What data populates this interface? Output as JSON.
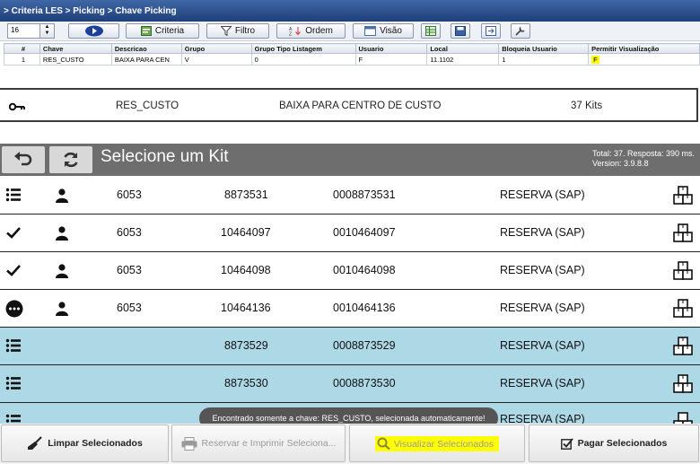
{
  "breadcrumb": {
    "text": "> Criteria LES > Picking > Chave Picking"
  },
  "toolbar": {
    "page_size": "16",
    "criteria_label": "Criteria",
    "filtro_label": "Filtro",
    "ordem_label": "Ordem",
    "visao_label": "Visão"
  },
  "grid": {
    "columns": [
      "#",
      "Chave",
      "Descricao",
      "Grupo",
      "Grupo Tipo Listagem",
      "Usuario",
      "Local",
      "Bloqueia Usuario",
      "Permitir Visualização"
    ],
    "row": [
      "1",
      "RES_CUSTO",
      "BAIXA PARA CEN",
      "V",
      "0",
      "F",
      "11.1102",
      "1",
      "F"
    ]
  },
  "summary": {
    "key": "RES_CUSTO",
    "description": "BAIXA PARA CENTRO DE CUSTO",
    "kits": "37 Kits"
  },
  "kit_header": {
    "title": "Selecione um Kit",
    "stats": "Total: 37. Resposta: 390 ms.",
    "version": "Version: 3.9.8.8"
  },
  "rows": [
    {
      "status_icon": "list-icon",
      "user": true,
      "code": "6053",
      "kit": "8873531",
      "padded": "0008873531",
      "label": "RESERVA (SAP)",
      "style": "white"
    },
    {
      "status_icon": "check-icon",
      "user": true,
      "code": "6053",
      "kit": "10464097",
      "padded": "0010464097",
      "label": "RESERVA (SAP)",
      "style": "white"
    },
    {
      "status_icon": "check-icon",
      "user": true,
      "code": "6053",
      "kit": "10464098",
      "padded": "0010464098",
      "label": "RESERVA (SAP)",
      "style": "white"
    },
    {
      "status_icon": "more-icon",
      "user": true,
      "code": "6053",
      "kit": "10464136",
      "padded": "0010464136",
      "label": "RESERVA (SAP)",
      "style": "white"
    },
    {
      "status_icon": "list-icon",
      "user": false,
      "code": "",
      "kit": "8873529",
      "padded": "0008873529",
      "label": "RESERVA (SAP)",
      "style": "blue"
    },
    {
      "status_icon": "list-icon",
      "user": false,
      "code": "",
      "kit": "8873530",
      "padded": "0008873530",
      "label": "RESERVA (SAP)",
      "style": "blue"
    },
    {
      "status_icon": "list-icon",
      "user": false,
      "code": "",
      "kit": "",
      "padded": "",
      "label": "RESERVA (SAP)",
      "style": "blue"
    }
  ],
  "toast": "Encontrado somente a chave: RES_CUSTO, selecionada automaticamente!",
  "bottom": {
    "clear": "Limpar Selecionados",
    "reserve_print": "Reservar e Imprimir Seleciona...",
    "view": "Visualizar Selecionados",
    "pay": "Pagar Selecionados"
  },
  "colors": {
    "highlight": "#ffff00",
    "row_blue": "#add8e6",
    "header_gray": "#6e6e6e",
    "crumb_blue": "#2b4f8f"
  }
}
